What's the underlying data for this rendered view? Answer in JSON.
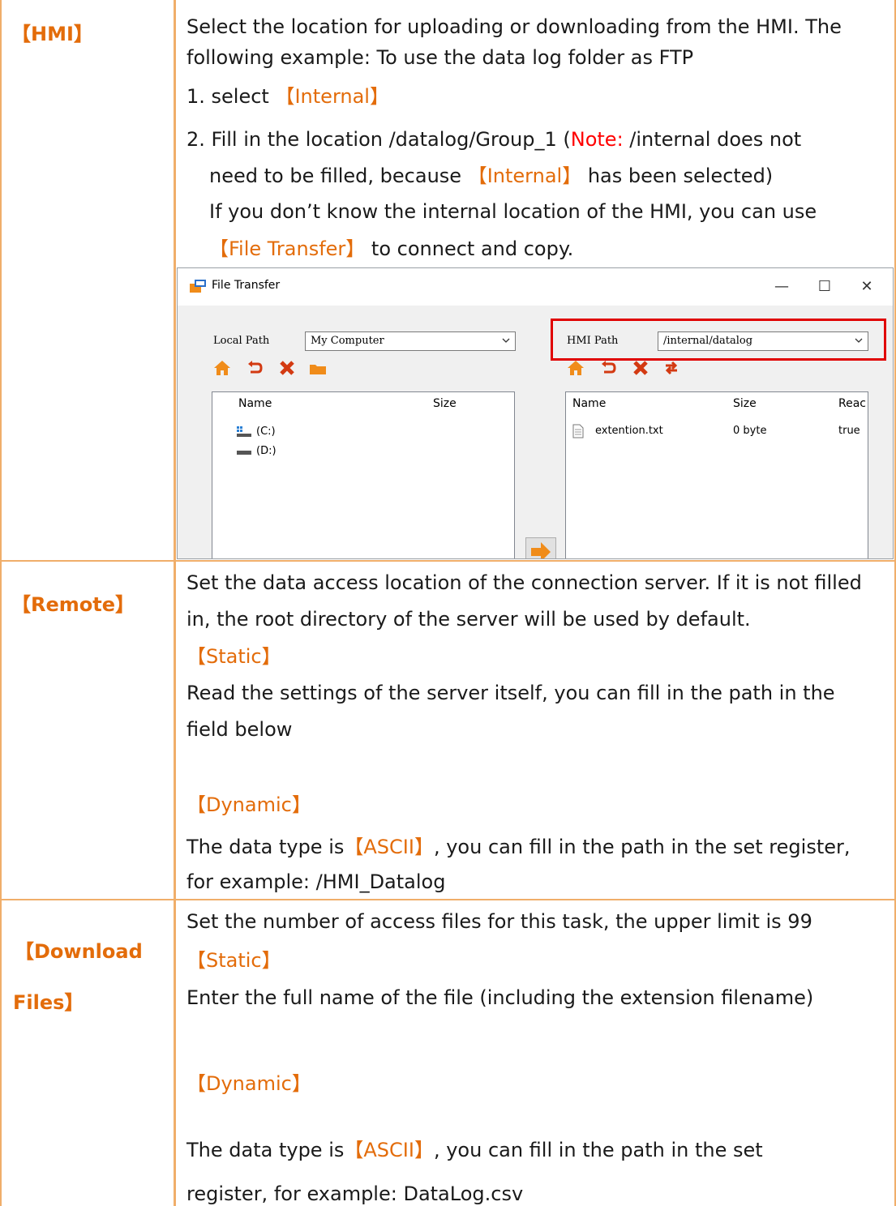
{
  "rows": {
    "hmi": {
      "label": "【HMI】",
      "desc_line1": "Select the location for uploading or downloading from the HMI. The",
      "desc_line2": "following example: To use the data log folder as FTP",
      "step1_prefix": "1.  select",
      "step1_ref": "【Internal】",
      "step2_prefix": "2.  Fill in the location /datalog/Group_1 (",
      "step2_note": "Note:",
      "step2_suffix": " /internal does not",
      "step2_line2_prefix": "need to be filled, because",
      "step2_line2_ref": "【Internal】",
      "step2_line2_suffix": " has been selected)",
      "tip_line1": "If you don’t know the internal location of the HMI, you can use",
      "tip_ref": "【File Transfer】",
      "tip_suffix": " to connect and copy."
    },
    "remote": {
      "label": "【Remote】",
      "desc_line1": "Set the data access location of the connection server. If it is not filled",
      "desc_line2": "in, the root directory of the server will be used by default.",
      "static_heading": "【Static】",
      "static_line1": "Read the settings of the server itself, you can fill in the path in the",
      "static_line2": "field below",
      "dynamic_heading": "【Dynamic】",
      "dynamic_prefix": "The data type is",
      "dynamic_ref": "【ASCII】",
      "dynamic_suffix": ", you can fill in the path in the set register,",
      "dynamic_line2": "for example: /HMI_Datalog"
    },
    "download": {
      "label_line1": "【Download",
      "label_line2": "Files】",
      "desc_line1": "Set the number of access files for this task, the upper limit is 99",
      "static_heading": "【Static】",
      "static_line1": "Enter the full name of the file (including the extension filename)",
      "dynamic_heading": "【Dynamic】",
      "dynamic_prefix": "The data type is",
      "dynamic_ref": "【ASCII】",
      "dynamic_suffix": ", you can fill in the path in the set",
      "dynamic_line2": "register, for example: DataLog.csv"
    }
  },
  "window": {
    "title": "File Transfer",
    "minimize_glyph": "—",
    "maximize_glyph": "☐",
    "close_glyph": "✕",
    "local_path_label": "Local Path",
    "local_path_value": "My Computer",
    "hmi_path_label": "HMI Path",
    "hmi_path_value": "/internal/datalog",
    "local_pane": {
      "col_name": "Name",
      "col_size": "Size",
      "items": [
        {
          "name": "(C:)",
          "icon": "drive-windows-icon"
        },
        {
          "name": "(D:)",
          "icon": "drive-icon"
        }
      ]
    },
    "hmi_pane": {
      "col_name": "Name",
      "col_size": "Size",
      "col_read": "Reac",
      "items": [
        {
          "name": "extention.txt",
          "size": "0 byte",
          "read": "true",
          "icon": "text-file-icon"
        }
      ]
    },
    "colors": {
      "highlight": "#e00000",
      "toolbar_orange": "#f08c1a",
      "toolbar_red": "#d33a12"
    }
  },
  "colors": {
    "accent": "#e36c0a",
    "border": "#f0ae6a",
    "note": "#ff0000"
  }
}
